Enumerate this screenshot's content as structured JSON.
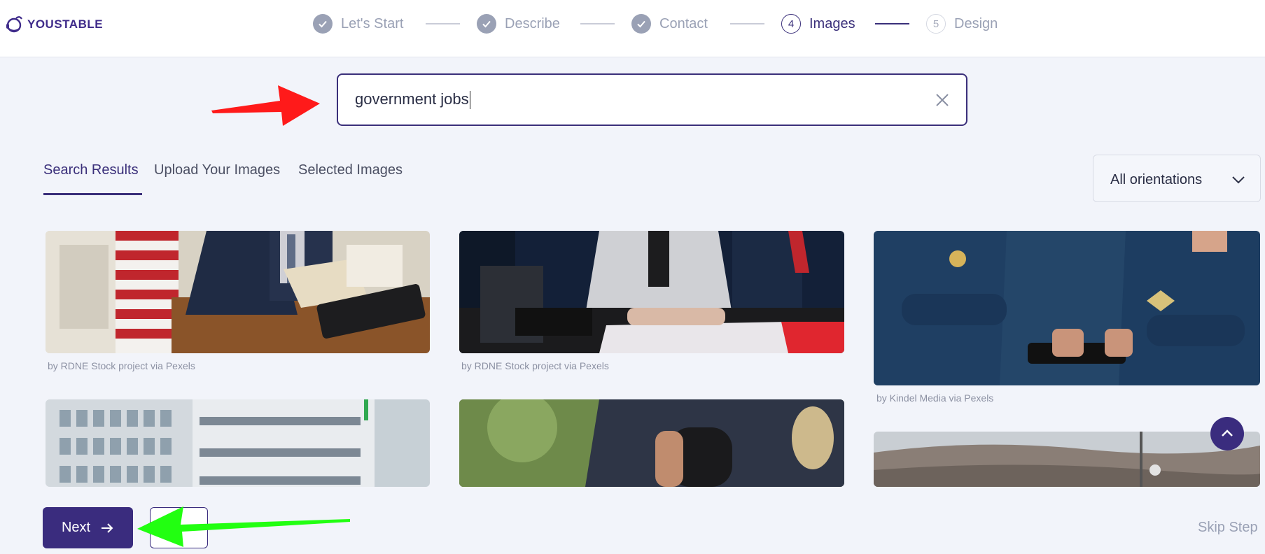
{
  "brand": {
    "name": "YOUSTABLE",
    "color": "#3f2b8a"
  },
  "steps": [
    {
      "number": "1",
      "label": "Let's Start",
      "status": "done"
    },
    {
      "number": "2",
      "label": "Describe",
      "status": "done"
    },
    {
      "number": "3",
      "label": "Contact",
      "status": "done"
    },
    {
      "number": "4",
      "label": "Images",
      "status": "active"
    },
    {
      "number": "5",
      "label": "Design",
      "status": "todo"
    }
  ],
  "search": {
    "value": "government jobs",
    "clear_icon": "close-icon"
  },
  "tabs": [
    {
      "label": "Search Results",
      "active": true
    },
    {
      "label": "Upload Your Images",
      "active": false
    },
    {
      "label": "Selected Images",
      "active": false
    }
  ],
  "orientation": {
    "selected": "All orientations",
    "icon": "chevron-down-icon"
  },
  "images": [
    {
      "id": "img1",
      "credit": "by RDNE Stock project via Pexels",
      "subject": "man at desk with flag"
    },
    {
      "id": "img2",
      "credit": "by RDNE Stock project via Pexels",
      "subject": "woman at desk"
    },
    {
      "id": "img3",
      "credit": "by Kindel Media via Pexels",
      "subject": "police officers"
    },
    {
      "id": "img4",
      "credit": "",
      "subject": "office building"
    },
    {
      "id": "img5",
      "credit": "",
      "subject": "officer with radio"
    },
    {
      "id": "img6",
      "credit": "",
      "subject": "hillside landscape"
    }
  ],
  "footer": {
    "next_label": "Next",
    "skip_label": "Skip Step"
  },
  "colors": {
    "accent": "#3a2c7e",
    "annotation_red": "#ff1a1a",
    "annotation_green": "#22ff11"
  }
}
